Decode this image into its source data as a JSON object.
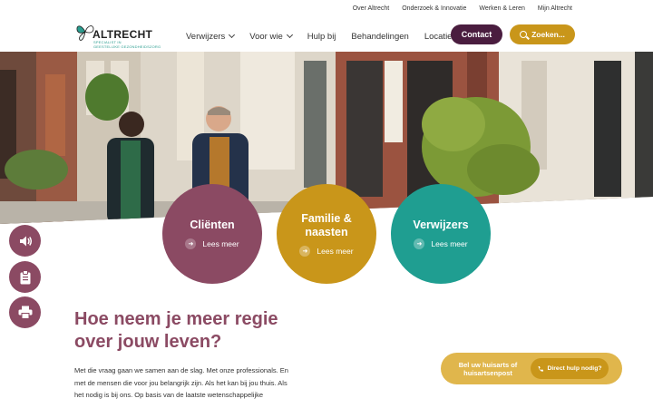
{
  "utility_nav": [
    "Over Altrecht",
    "Onderzoek & Innovatie",
    "Werken & Leren",
    "Mijn Altrecht"
  ],
  "logo": {
    "brand": "ALTRECHT",
    "tagline_line1": "SPECIALIST IN",
    "tagline_line2": "GEESTELIJKE GEZONDHEIDSZORG"
  },
  "main_nav": [
    {
      "label": "Verwijzers",
      "dropdown": true,
      "active": false
    },
    {
      "label": "Voor wie",
      "dropdown": true,
      "active": true
    },
    {
      "label": "Hulp bij",
      "dropdown": false,
      "active": false
    },
    {
      "label": "Behandelingen",
      "dropdown": false,
      "active": false
    },
    {
      "label": "Locaties",
      "dropdown": false,
      "active": false
    }
  ],
  "contact_label": "Contact",
  "search_label": "Zoeken...",
  "circles": [
    {
      "title": "Cliënten",
      "more": "Lees meer",
      "color": "#8b4a63"
    },
    {
      "title": "Familie & naasten",
      "title_line1": "Familie &",
      "title_line2": "naasten",
      "more": "Lees meer",
      "color": "#c9961a"
    },
    {
      "title": "Verwijzers",
      "more": "Lees meer",
      "color": "#1f9e91"
    }
  ],
  "tools": [
    {
      "icon": "speaker-icon"
    },
    {
      "icon": "clipboard-icon"
    },
    {
      "icon": "printer-icon"
    }
  ],
  "intro": {
    "headline": "Hoe neem je meer regie over jouw leven?",
    "headline_line1": "Hoe neem je meer regie",
    "headline_line2": "over jouw leven?",
    "body_line1": "Met die vraag gaan we samen aan de slag. Met onze professionals. En",
    "body_line2": "met de mensen die voor jou belangrijk zijn. Als het kan bij jou thuis. Als",
    "body_line3": "het nodig is bij ons. Op basis van de laatste wetenschappelijke"
  },
  "gp_banner": {
    "text_line1": "Bel uw huisarts of",
    "text_line2": "huisartsenpost",
    "button_label": "Direct hulp nodig?"
  },
  "colors": {
    "primary": "#8b4a63",
    "gold": "#c9961a",
    "teal": "#1f9e91",
    "contact": "#4a1d3f"
  }
}
